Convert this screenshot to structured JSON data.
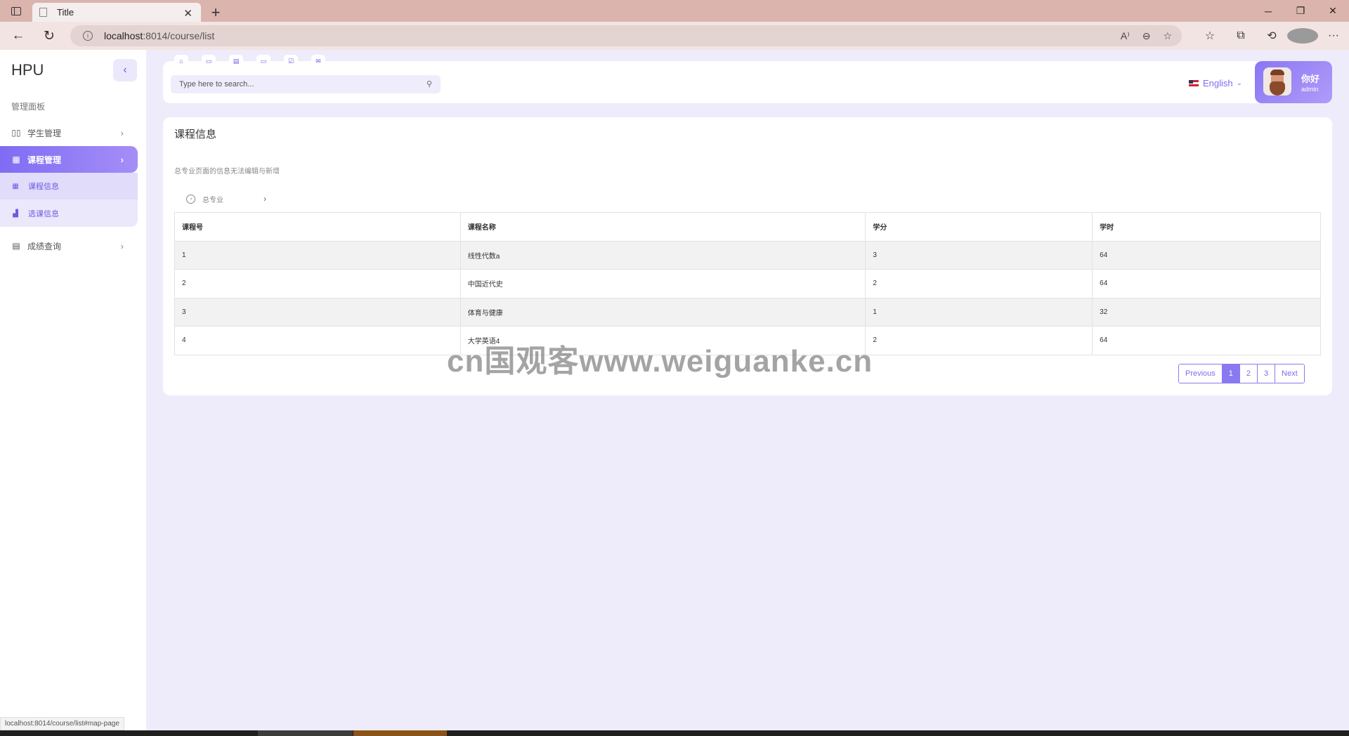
{
  "browser": {
    "tab_title": "Title",
    "tab_close": "✕",
    "new_tab": "+",
    "url_host": "localhost",
    "url_path": ":8014/course/list",
    "status_url": "localhost:8014/course/list#map-page"
  },
  "sidebar": {
    "brand": "HPU",
    "heading": "管理面板",
    "items": [
      {
        "label": "学生管理",
        "icon": "columns-icon"
      },
      {
        "label": "课程管理",
        "icon": "table-icon"
      },
      {
        "label": "成绩查询",
        "icon": "calculator-icon"
      }
    ],
    "submenu": [
      {
        "label": "课程信息",
        "icon": "table-icon"
      },
      {
        "label": "选课信息",
        "icon": "chart-icon"
      }
    ]
  },
  "header": {
    "search_placeholder": "Type here to search...",
    "language": "English",
    "greeting": "你好",
    "username": "admin"
  },
  "main": {
    "title": "课程信息",
    "note": "总专业页面的信息无法编辑与新增",
    "breadcrumb": "总专业",
    "table": {
      "headers": [
        "课程号",
        "课程名称",
        "学分",
        "学时"
      ],
      "rows": [
        [
          "1",
          "线性代数a",
          "3",
          "64"
        ],
        [
          "2",
          "中国近代史",
          "2",
          "64"
        ],
        [
          "3",
          "体育与健康",
          "1",
          "32"
        ],
        [
          "4",
          "大学英语4",
          "2",
          "64"
        ]
      ]
    },
    "pagination": {
      "previous": "Previous",
      "pages": [
        "1",
        "2",
        "3"
      ],
      "current": "1",
      "next": "Next"
    }
  },
  "watermark": "cn国观客www.weiguanke.cn",
  "colors": {
    "accent": "#7f6cf3",
    "page_bg": "#eeecfb",
    "tabbar": "#dbb4ae"
  }
}
